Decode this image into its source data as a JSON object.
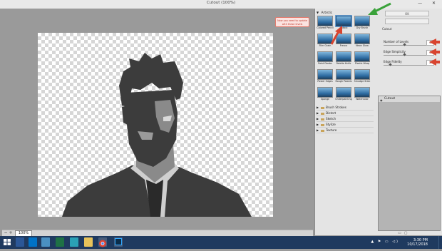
{
  "window": {
    "title": "Cutout (100%)",
    "controls": "—  ✕"
  },
  "statusbar": {
    "zoom_out": "−",
    "zoom_in": "+",
    "zoom": "100%"
  },
  "gallery": {
    "category_open": "Artistic",
    "thumbs": [
      {
        "label": "Colored Pencil"
      },
      {
        "label": "Cutout"
      },
      {
        "label": "Dry Brush"
      },
      {
        "label": "Film Grain"
      },
      {
        "label": "Fresco"
      },
      {
        "label": "Neon Glow"
      },
      {
        "label": "Paint Daubs"
      },
      {
        "label": "Palette Knife"
      },
      {
        "label": "Plastic Wrap"
      },
      {
        "label": "Poster Edges"
      },
      {
        "label": "Rough Pastels"
      },
      {
        "label": "Smudge Stick"
      },
      {
        "label": "Sponge"
      },
      {
        "label": "Underpainting"
      },
      {
        "label": "Watercolor"
      }
    ],
    "categories": [
      "Brush Strokes",
      "Distort",
      "Sketch",
      "Stylize",
      "Texture"
    ]
  },
  "right_panel": {
    "ok_label": "OK",
    "filter_select": "Cutout",
    "params": [
      {
        "label": "Number of Levels",
        "value": "4"
      },
      {
        "label": "Edge Simplicity",
        "value": "4"
      },
      {
        "label": "Edge Fidelity",
        "value": "2"
      }
    ],
    "layers": [
      {
        "label": "Cutout"
      }
    ]
  },
  "callout": {
    "text": "Now you need to update with these levels"
  },
  "taskbar": {
    "time": "3:30 PM",
    "date": "10/17/2018",
    "tray_icons": "▲ ⚑ ▭ ◁)"
  },
  "colors": {
    "accent_arrow_green": "#3aa23a",
    "accent_arrow_red": "#d8442f",
    "taskbar": "#1f3a5f"
  }
}
